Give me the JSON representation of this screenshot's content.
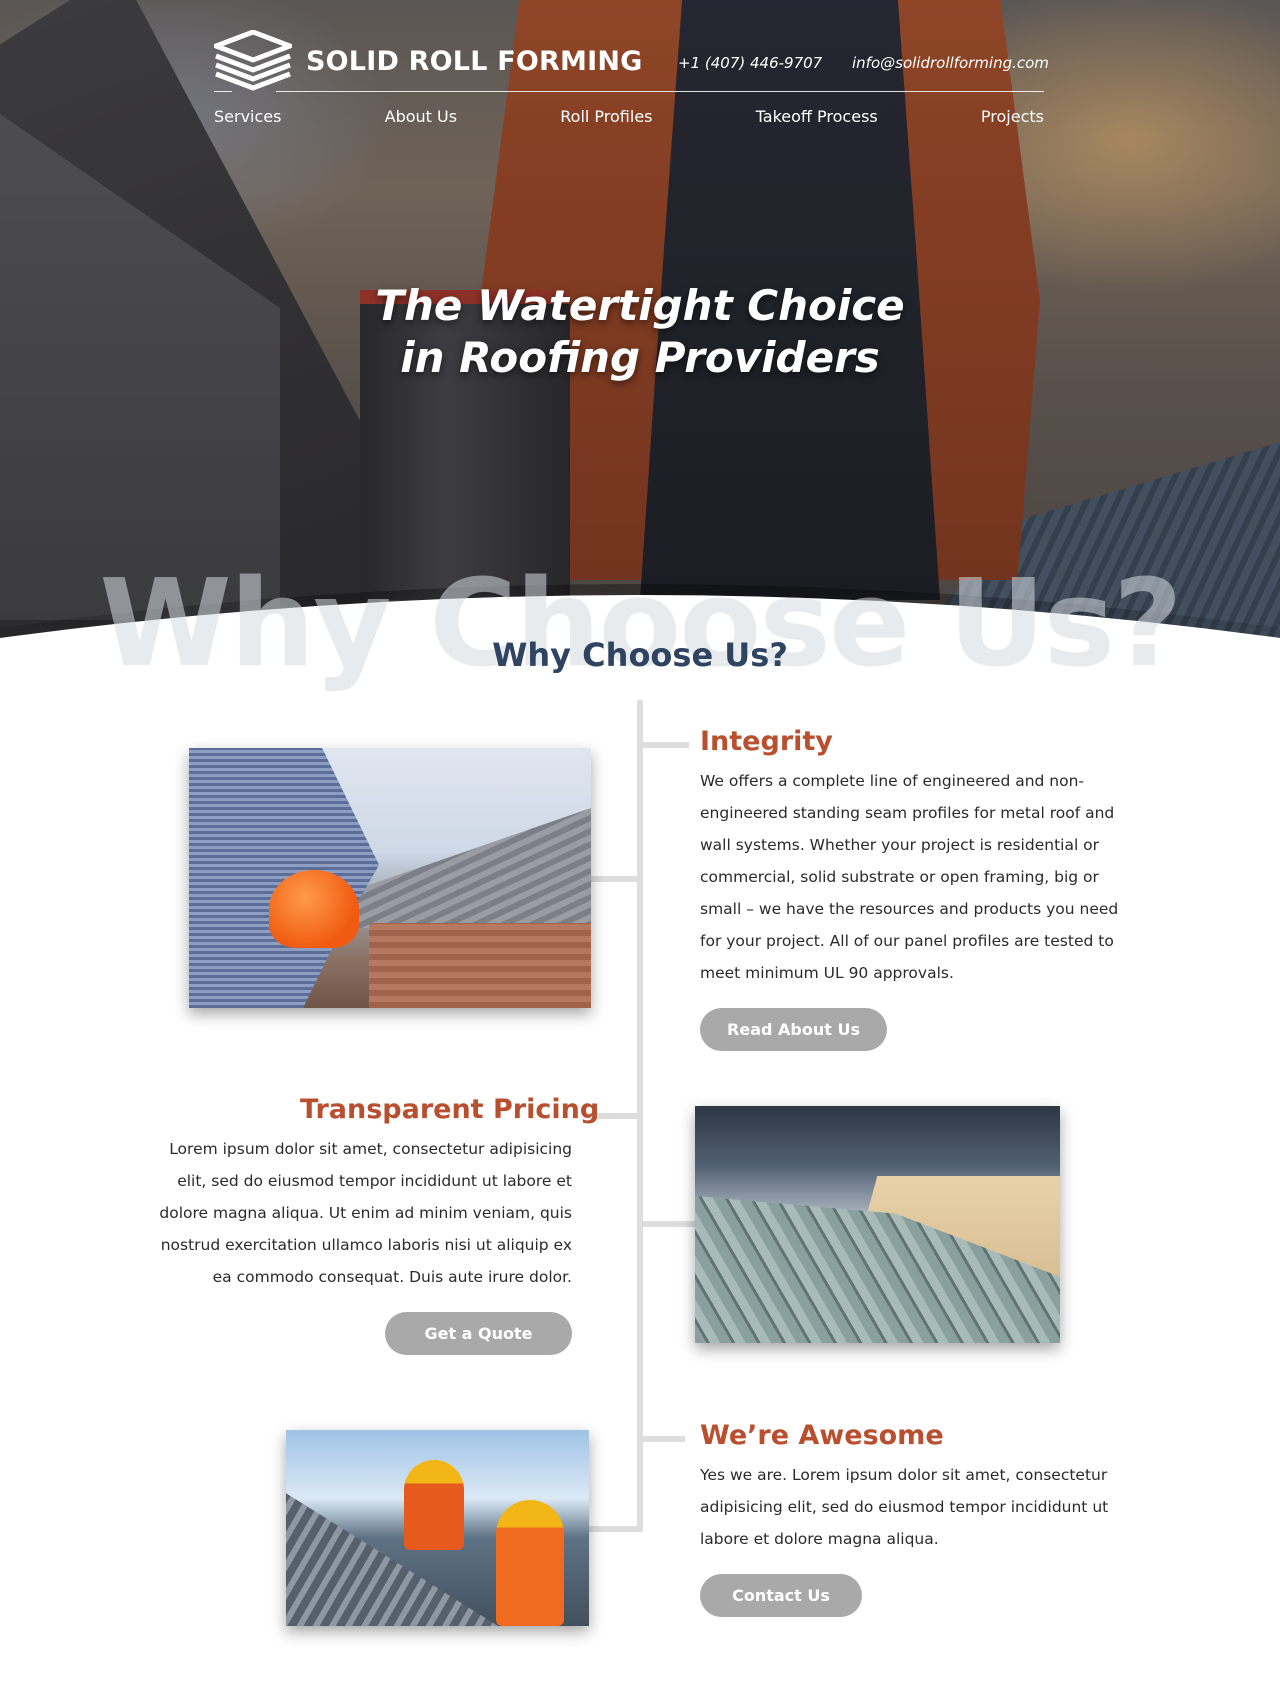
{
  "header": {
    "brand_name": "SOLID ROLL FORMING",
    "logo_icon": "stacked-sheets-icon",
    "phone": "+1 (407) 446-9707",
    "email": "info@solidrollforming.com"
  },
  "nav": {
    "items": [
      {
        "label": "Services"
      },
      {
        "label": "About Us"
      },
      {
        "label": "Roll Profiles"
      },
      {
        "label": "Takeoff Process"
      },
      {
        "label": "Projects"
      }
    ]
  },
  "hero": {
    "title_line1": "The Watertight Choice",
    "title_line2": "in Roofing Providers"
  },
  "why": {
    "ghost_title": "Why Choose Us?",
    "title": "Why Choose Us?",
    "features": [
      {
        "title": "Integrity",
        "text": "We offers a complete line of engineered and non-engineered standing seam profiles for metal roof and wall systems. Whether your project is residential or commercial, solid substrate or open framing, big or small – we have the resources and products you need for your project. All of our panel profiles are tested to meet minimum UL 90 approvals.",
        "button": "Read About Us"
      },
      {
        "title": "Transparent Pricing",
        "text": "Lorem ipsum dolor sit amet, consectetur adipisicing elit, sed do eiusmod tempor incididunt ut labore et dolore magna aliqua. Ut enim ad minim veniam, quis nostrud exercitation ullamco laboris nisi ut aliquip ex ea commodo consequat. Duis aute irure dolor.",
        "button": "Get a Quote"
      },
      {
        "title": "We’re Awesome",
        "text": "Yes we are. Lorem ipsum dolor sit amet, consectetur adipisicing elit, sed do eiusmod tempor incididunt ut labore et dolore magna aliqua.",
        "button": "Contact Us"
      }
    ]
  },
  "colors": {
    "accent": "#b94f2e",
    "heading": "#2f4461",
    "button": "#a9a9a9",
    "timeline": "#dddddd"
  }
}
